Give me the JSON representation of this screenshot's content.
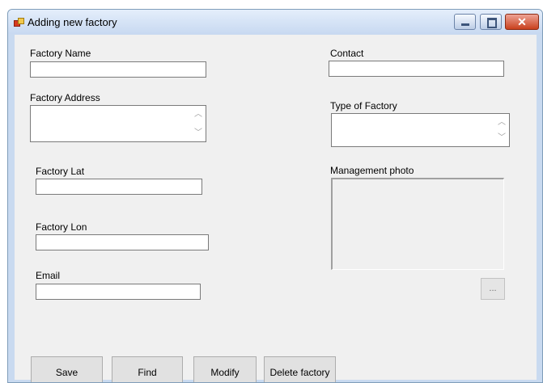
{
  "window": {
    "title": "Adding new factory",
    "controls": {
      "minimize_icon": "minimize-icon",
      "maximize_icon": "maximize-icon",
      "close_icon": "close-icon",
      "close_glyph": "✕"
    }
  },
  "form": {
    "factory_name": {
      "label": "Factory Name",
      "value": ""
    },
    "factory_address": {
      "label": "Factory Address",
      "value": ""
    },
    "factory_lat": {
      "label": "Factory Lat",
      "value": ""
    },
    "factory_lon": {
      "label": "Factory Lon",
      "value": ""
    },
    "email": {
      "label": "Email",
      "value": ""
    },
    "contact": {
      "label": "Contact",
      "value": ""
    },
    "type_of_factory": {
      "label": "Type of Factory",
      "value": ""
    },
    "management_photo": {
      "label": "Management photo",
      "browse_label": "..."
    }
  },
  "buttons": {
    "save": "Save",
    "find": "Find",
    "modify": "Modify",
    "delete": "Delete factory"
  },
  "colors": {
    "titlebar": "#c8d9f1",
    "client_bg": "#f0f0f0",
    "close_button": "#c9401d"
  }
}
